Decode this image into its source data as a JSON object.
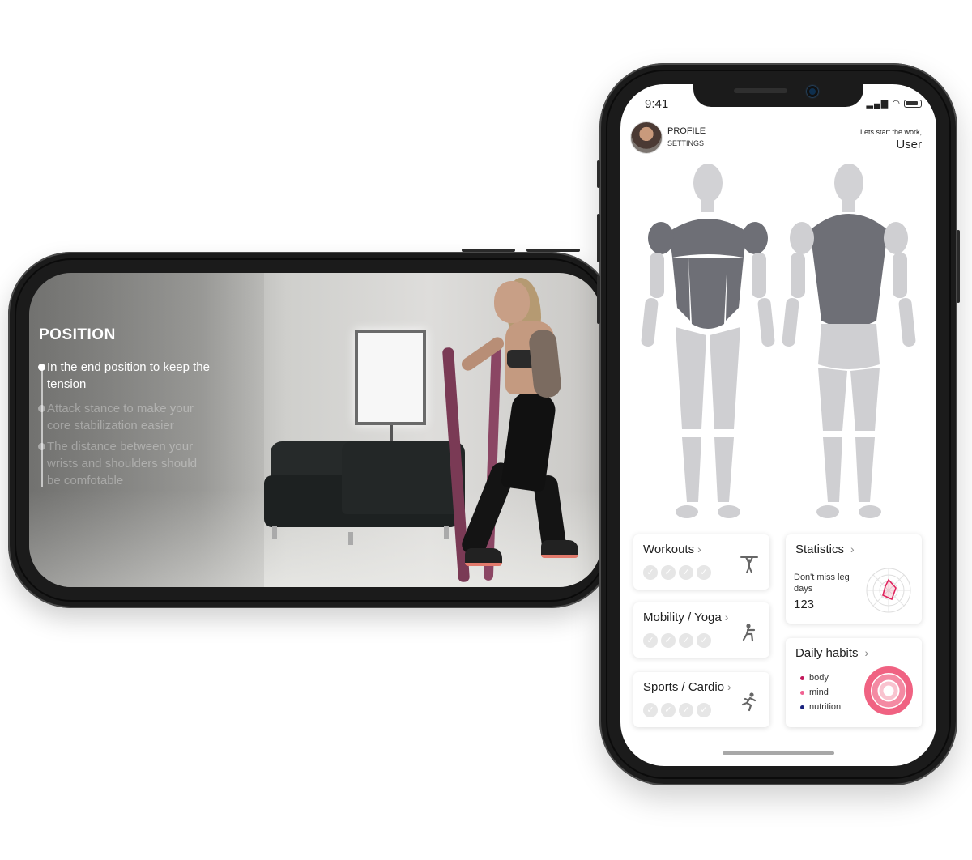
{
  "landscape": {
    "heading": "POSITION",
    "steps": [
      {
        "text": "In the end position to keep the tension",
        "active": true
      },
      {
        "text": "Attack stance to make your core stabilization easier",
        "active": false
      },
      {
        "text": "The distance between your wrists and shoulders should be comfotable",
        "active": false
      }
    ]
  },
  "status": {
    "time": "9:41"
  },
  "header": {
    "profile_label": "PROFILE",
    "settings_label": "SETTINGS",
    "greeting": "Lets start the work,",
    "user_name": "User"
  },
  "cards": {
    "workouts": {
      "title": "Workouts",
      "completed": 0,
      "total": 4,
      "icon": "pullup-icon"
    },
    "mobility": {
      "title": "Mobility / Yoga",
      "completed": 0,
      "total": 4,
      "icon": "squat-icon"
    },
    "sports": {
      "title": "Sports / Cardio",
      "completed": 0,
      "total": 4,
      "icon": "running-icon"
    },
    "statistics": {
      "title": "Statistics",
      "subtitle": "Don't miss leg days",
      "value": "123",
      "icon": "radar-chart-icon"
    },
    "habits": {
      "title": "Daily habits",
      "items": [
        {
          "label": "body",
          "color": "#c2185b"
        },
        {
          "label": "mind",
          "color": "#f06292"
        },
        {
          "label": "nutrition",
          "color": "#1a237e"
        }
      ],
      "ring_color": "#f06282",
      "icon": "donut-chart-icon"
    }
  },
  "colors": {
    "accent": "#f06282",
    "muscle_highlight": "#6e6f76",
    "muscle_base": "#cfcfd2"
  }
}
